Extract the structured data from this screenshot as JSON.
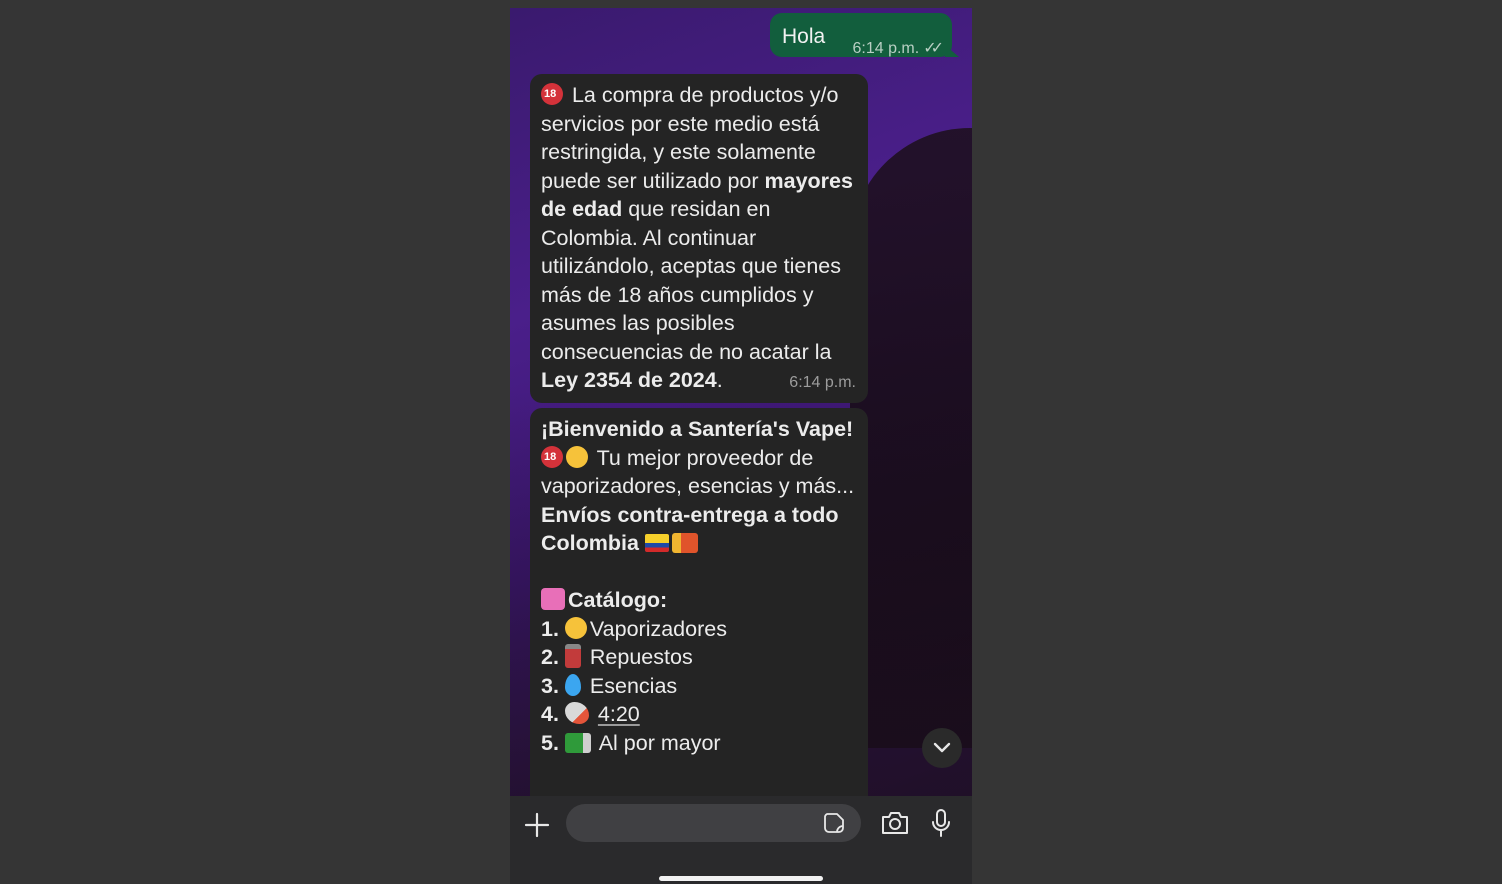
{
  "outgoing": {
    "text": "Hola",
    "time": "6:14 p.m."
  },
  "message1": {
    "line_a": " La compra de productos y/o servicios por este medio está restringida, y este solamente puede ser utilizado por ",
    "bold_a": "mayores de edad",
    "line_b": " que residan en Colombia. Al continuar utilizándolo, aceptas que tienes más de 18 años cumplidos y asumes las posibles consecuencias de no acatar la ",
    "bold_b": "Ley 2354 de 2024",
    "line_c": ".",
    "time": "6:14 p.m."
  },
  "message2": {
    "welcome": "¡Bienvenido a Santería's Vape!",
    "tagline": " Tu mejor proveedor de vaporizadores, esencias y más...",
    "shipping": "Envíos contra-entrega a todo Colombia",
    "catalog_title": "Catálogo:",
    "items": [
      {
        "num": "1.",
        "label": "Vaporizadores",
        "icon": "smoke-face-emoji"
      },
      {
        "num": "2.",
        "label": "Repuestos",
        "icon": "battery-emoji"
      },
      {
        "num": "3.",
        "label": "Esencias",
        "icon": "droplet-emoji"
      },
      {
        "num": "4.",
        "label": "4:20",
        "icon": "rocket-emoji"
      },
      {
        "num": "5.",
        "label": "Al por mayor",
        "icon": "truck-emoji"
      }
    ]
  },
  "colors": {
    "outgoing_bubble": "#125e3d",
    "incoming_bubble": "#242424",
    "input_bar": "#2a2a2c"
  }
}
